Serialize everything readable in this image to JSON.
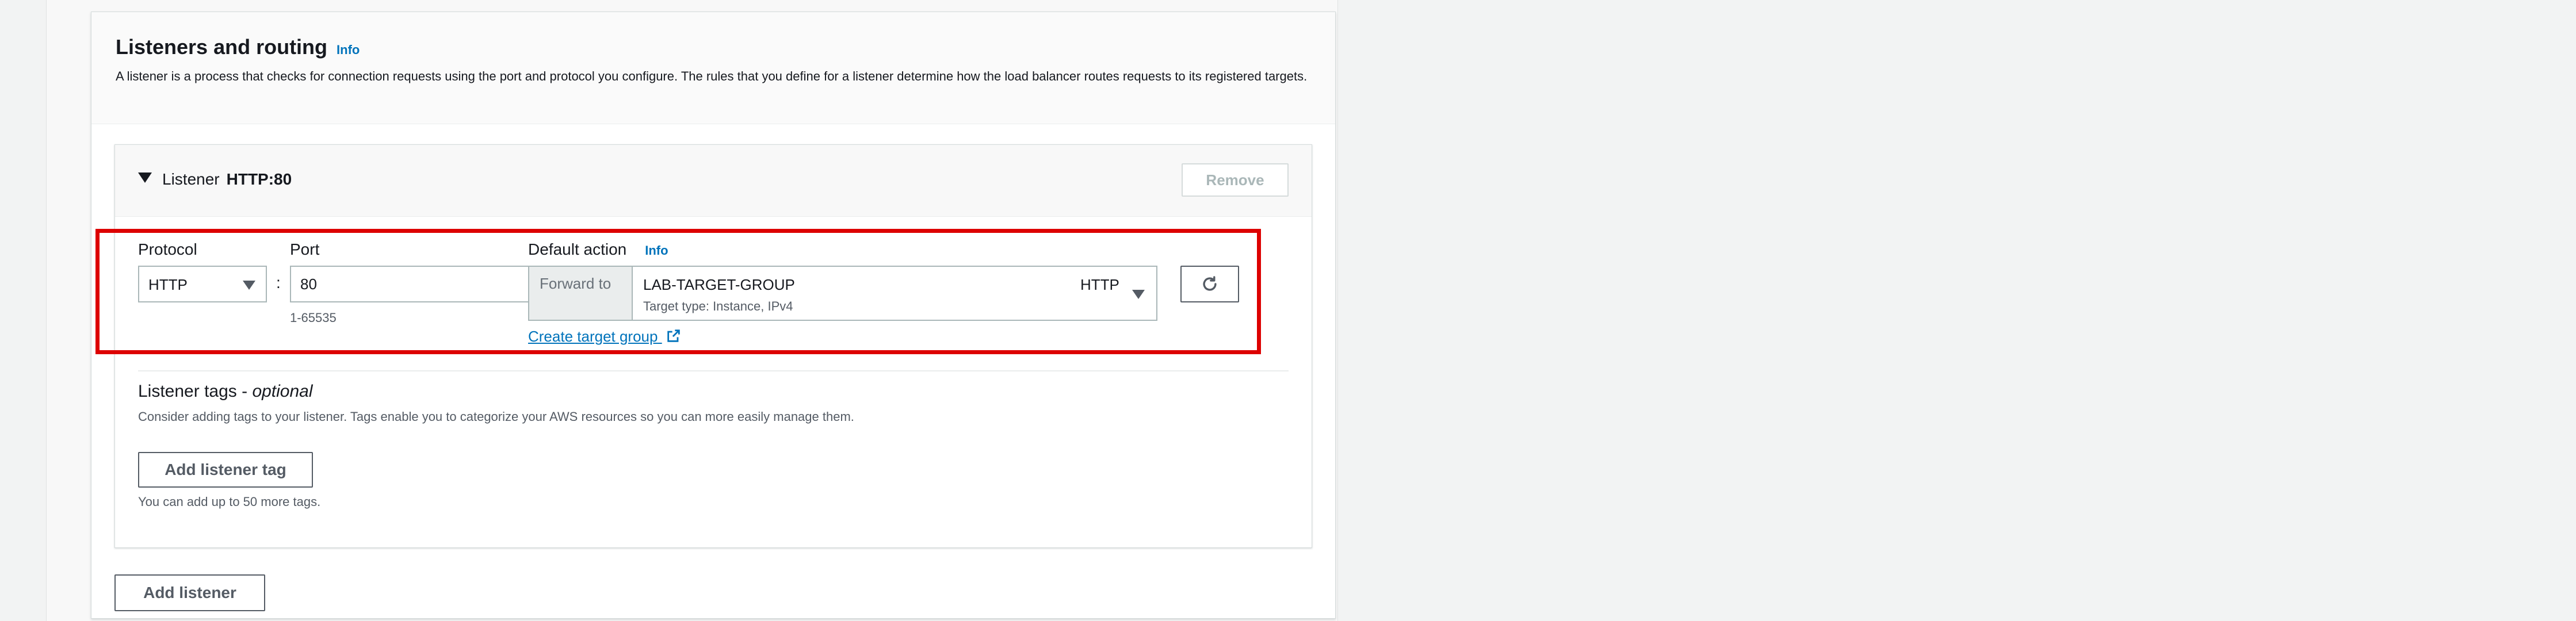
{
  "section": {
    "title": "Listeners and routing",
    "info": "Info",
    "description": "A listener is a process that checks for connection requests using the port and protocol you configure. The rules that you define for a listener determine how the load balancer routes requests to its registered targets."
  },
  "listener": {
    "label": "Listener",
    "name": "HTTP:80",
    "remove": "Remove",
    "protocol_label": "Protocol",
    "protocol_value": "HTTP",
    "colon": ":",
    "port_label": "Port",
    "port_value": "80",
    "port_hint": "1-65535",
    "default_action_label": "Default action",
    "default_action_info": "Info",
    "forward_to": "Forward to",
    "target_group_name": "LAB-TARGET-GROUP",
    "target_group_type": "Target type: Instance, IPv4",
    "target_group_protocol": "HTTP",
    "create_target_group": "Create target group",
    "tags_title": "Listener tags - ",
    "tags_title_optional": "optional",
    "tags_description": "Consider adding tags to your listener. Tags enable you to categorize your AWS resources so you can more easily manage them.",
    "add_tag": "Add listener tag",
    "tags_limit": "You can add up to 50 more tags."
  },
  "add_listener": "Add listener",
  "highlight_color": "#dd0000",
  "link_color": "#0073bb"
}
